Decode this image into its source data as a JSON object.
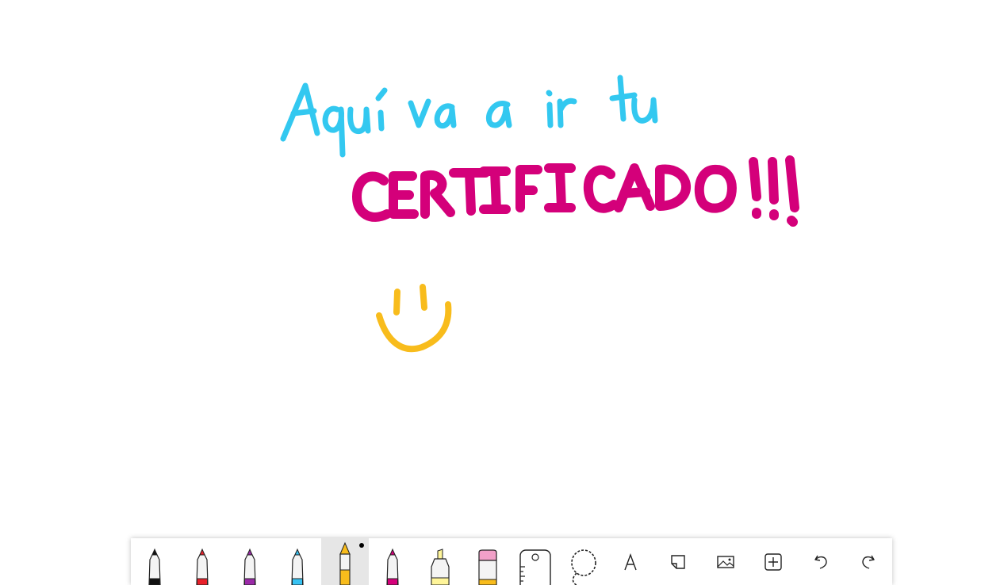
{
  "canvas": {
    "handwriting_line_1": "Aquí va a ir tu",
    "handwriting_line_2": "CERTIFICADO!!!",
    "colors": {
      "line_1": "#33c8f0",
      "line_2": "#d4007a",
      "smiley": "#f8bc1c"
    }
  },
  "toolbar": {
    "tools": [
      {
        "name": "pen-black",
        "icon": "pen-icon",
        "color": "#111111"
      },
      {
        "name": "pen-red",
        "icon": "pen-icon",
        "color": "#e8202a"
      },
      {
        "name": "pen-purple",
        "icon": "pen-icon",
        "color": "#9b2aa8"
      },
      {
        "name": "pen-blue",
        "icon": "pen-icon",
        "color": "#37c2f2"
      },
      {
        "name": "pen-yellow",
        "icon": "pencil-icon",
        "color": "#f8bc1c",
        "active": true
      },
      {
        "name": "pen-magenta",
        "icon": "pen-icon",
        "color": "#d4007a"
      },
      {
        "name": "highlighter",
        "icon": "highlighter-icon",
        "color": "#fff59a"
      },
      {
        "name": "eraser",
        "icon": "eraser-icon",
        "color": "#f2a0c8"
      },
      {
        "name": "ruler",
        "icon": "ruler-icon"
      },
      {
        "name": "lasso-select",
        "icon": "lasso-icon"
      },
      {
        "name": "text",
        "icon": "text-icon"
      },
      {
        "name": "sticky-note",
        "icon": "sticky-note-icon"
      },
      {
        "name": "image",
        "icon": "image-icon"
      },
      {
        "name": "add",
        "icon": "add-icon"
      },
      {
        "name": "undo",
        "icon": "undo-icon"
      },
      {
        "name": "redo",
        "icon": "redo-icon"
      }
    ]
  }
}
